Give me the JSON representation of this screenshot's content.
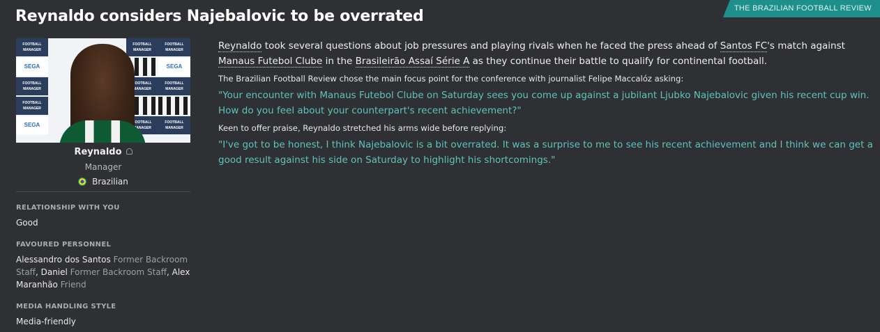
{
  "source": "THE BRAZILIAN FOOTBALL REVIEW",
  "headline": "Reynaldo considers Najebalovic to be overrated",
  "profile": {
    "photo_sponsors": [
      "FOOTBALL MANAGER",
      "SEGA"
    ],
    "name": "Reynaldo",
    "role": "Manager",
    "nationality": "Brazilian",
    "nationality_icon": "brazil-flag-icon",
    "status_icon": "person-icon"
  },
  "attributes": {
    "relationship": {
      "label": "RELATIONSHIP WITH YOU",
      "value": "Good"
    },
    "favoured": {
      "label": "FAVOURED PERSONNEL",
      "people": [
        {
          "name": "Alessandro dos Santos",
          "role": "Former Backroom Staff"
        },
        {
          "name": "Daniel",
          "role": "Former Backroom Staff"
        },
        {
          "name": "Alex Maranhão",
          "role": "Friend"
        }
      ]
    },
    "media_style": {
      "label": "MEDIA HANDLING STYLE",
      "value": "Media-friendly"
    }
  },
  "article": {
    "intro": {
      "manager_link": "Reynaldo",
      "text1": " took several questions about job pressures and playing rivals when he faced the press ahead of ",
      "club_link": "Santos FC",
      "text2": "'s match against ",
      "opponent_link": "Manaus Futebol Clube",
      "text3": " in the ",
      "competition_link": "Brasileirão Assaí Série A",
      "text4": " as they continue their battle to qualify for continental football."
    },
    "focus_line": "The Brazilian Football Review chose the main focus point for the conference with journalist Felipe Maccalóz asking:",
    "question": "\"Your encounter with Manaus Futebol Clube on Saturday sees you come up against a jubilant Ljubko Najebalovic given his recent cup win. How do you feel about your counterpart's recent achievement?\"",
    "reaction_line": "Keen to offer praise, Reynaldo stretched his arms wide before replying:",
    "answer": "\"I've got to be honest, I think Najebalovic is a bit overrated. It was a surprise to me to see his recent achievement and I think we can get a good result against his side on Saturday to highlight his shortcomings.\""
  },
  "colors": {
    "background": "#2f3033",
    "accent": "#1e8f8b",
    "quote": "#5ec4b8"
  }
}
